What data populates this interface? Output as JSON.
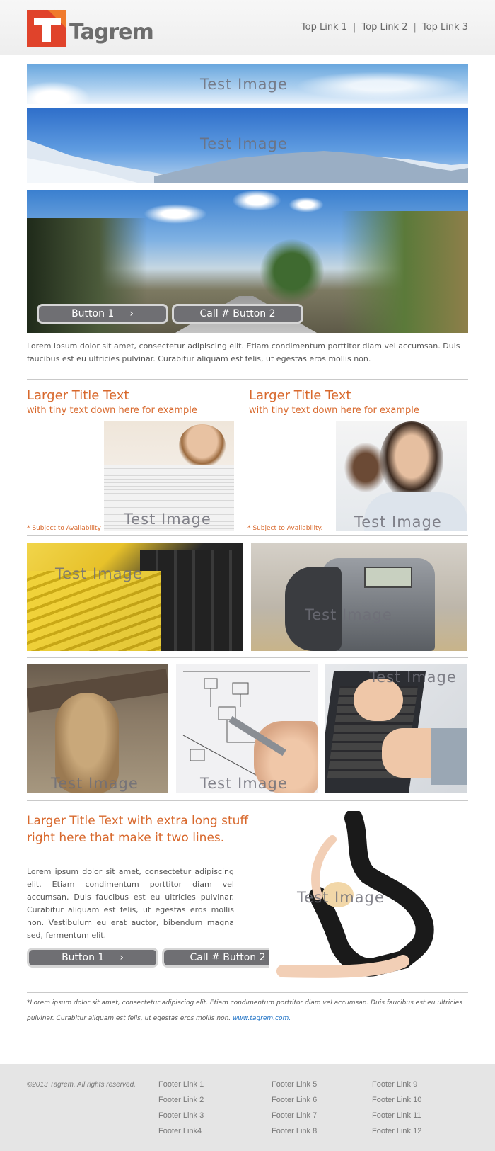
{
  "header": {
    "logo_text": "Tagrem",
    "top_links": [
      "Top Link 1",
      "Top Link 2",
      "Top Link 3"
    ],
    "separator": "|"
  },
  "hero": {
    "image_label": "Test Image",
    "button1_label": "Button 1",
    "button2_label": "Call # Button 2",
    "paragraph": "Lorem ipsum dolor sit amet, consectetur adipiscing elit. Etiam condimentum porttitor diam vel accumsan. Duis faucibus est eu ultricies pulvinar. Curabitur aliquam est felis, ut egestas eros mollis non."
  },
  "two_col": {
    "left": {
      "title": "Larger Title Text",
      "subtitle": "with tiny text down here for example",
      "note": "* Subject to Availability",
      "image_label": "Test Image"
    },
    "right": {
      "title": "Larger Title Text",
      "subtitle": "with tiny text down here for example",
      "note": "* Subject to Availability.",
      "image_label": "Test Image"
    }
  },
  "gallery": {
    "label": "Test Image"
  },
  "feature": {
    "title_line1": "Larger Title Text with extra long stuff",
    "title_line2": "right here that make it two lines.",
    "paragraph": "Lorem ipsum dolor sit amet, consectetur adipiscing elit. Etiam condimentum porttitor diam vel accumsan. Duis faucibus est eu ultricies pulvinar. Curabitur aliquam est felis, ut egestas eros mollis non. Vestibulum eu erat auctor, bibendum magna sed, fermentum elit.",
    "button1_label": "Button 1",
    "button2_label": "Call # Button 2",
    "image_label": "Test Image"
  },
  "disclaimer": {
    "text": "*Lorem ipsum dolor sit amet, consectetur adipiscing elit. Etiam condimentum porttitor diam vel accumsan. Duis faucibus est eu ultricies pulvinar. Curabitur aliquam est felis, ut egestas eros mollis non.",
    "link": "www.tagrem.com."
  },
  "footer": {
    "copyright": "©2013 Tagrem.  All rights reserved.",
    "col1": [
      "Footer Link 1",
      "Footer Link 2",
      "Footer Link 3",
      "Footer Link4"
    ],
    "col2": [
      "Footer Link 5",
      "Footer Link 6",
      "Footer Link 7",
      "Footer Link 8"
    ],
    "col3": [
      "Footer Link 9",
      "Footer Link 10",
      "Footer Link 11",
      "Footer Link 12"
    ]
  },
  "colors": {
    "accent": "#d8682c",
    "button": "#6f6f73",
    "link": "#1a6fc4",
    "logo_red": "#e0432b"
  }
}
